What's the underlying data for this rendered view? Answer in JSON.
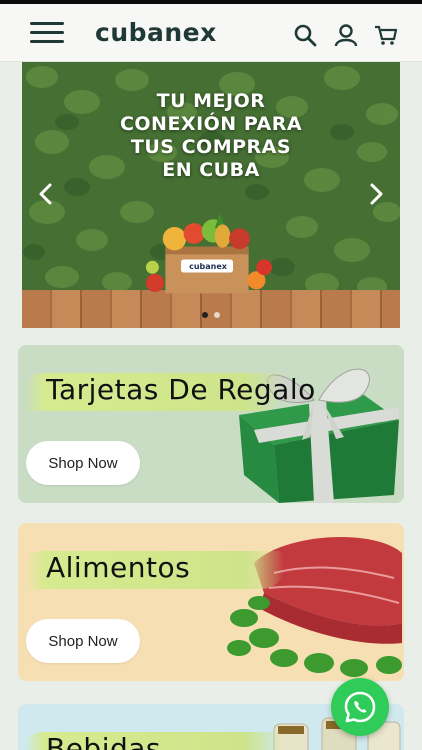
{
  "header": {
    "logo": "cubanex",
    "icons": [
      "menu-icon",
      "search-icon",
      "user-icon",
      "cart-icon"
    ]
  },
  "hero": {
    "title_lines": [
      "TU MEJOR",
      "CONEXIÓN PARA",
      "TUS COMPRAS",
      "EN CUBA"
    ],
    "box_logo": "cubanex",
    "slide_count": 2,
    "active_slide": 1
  },
  "categories": [
    {
      "title": "Tarjetas De Regalo",
      "button": "Shop Now",
      "bg": "#c9dcc4"
    },
    {
      "title": "Alimentos",
      "button": "Shop Now",
      "bg": "#f7dfb4"
    },
    {
      "title": "Bebidas",
      "bg": "#cfe9ef"
    }
  ],
  "colors": {
    "brand": "#1f3a36",
    "whatsapp": "#2fcc5a"
  }
}
